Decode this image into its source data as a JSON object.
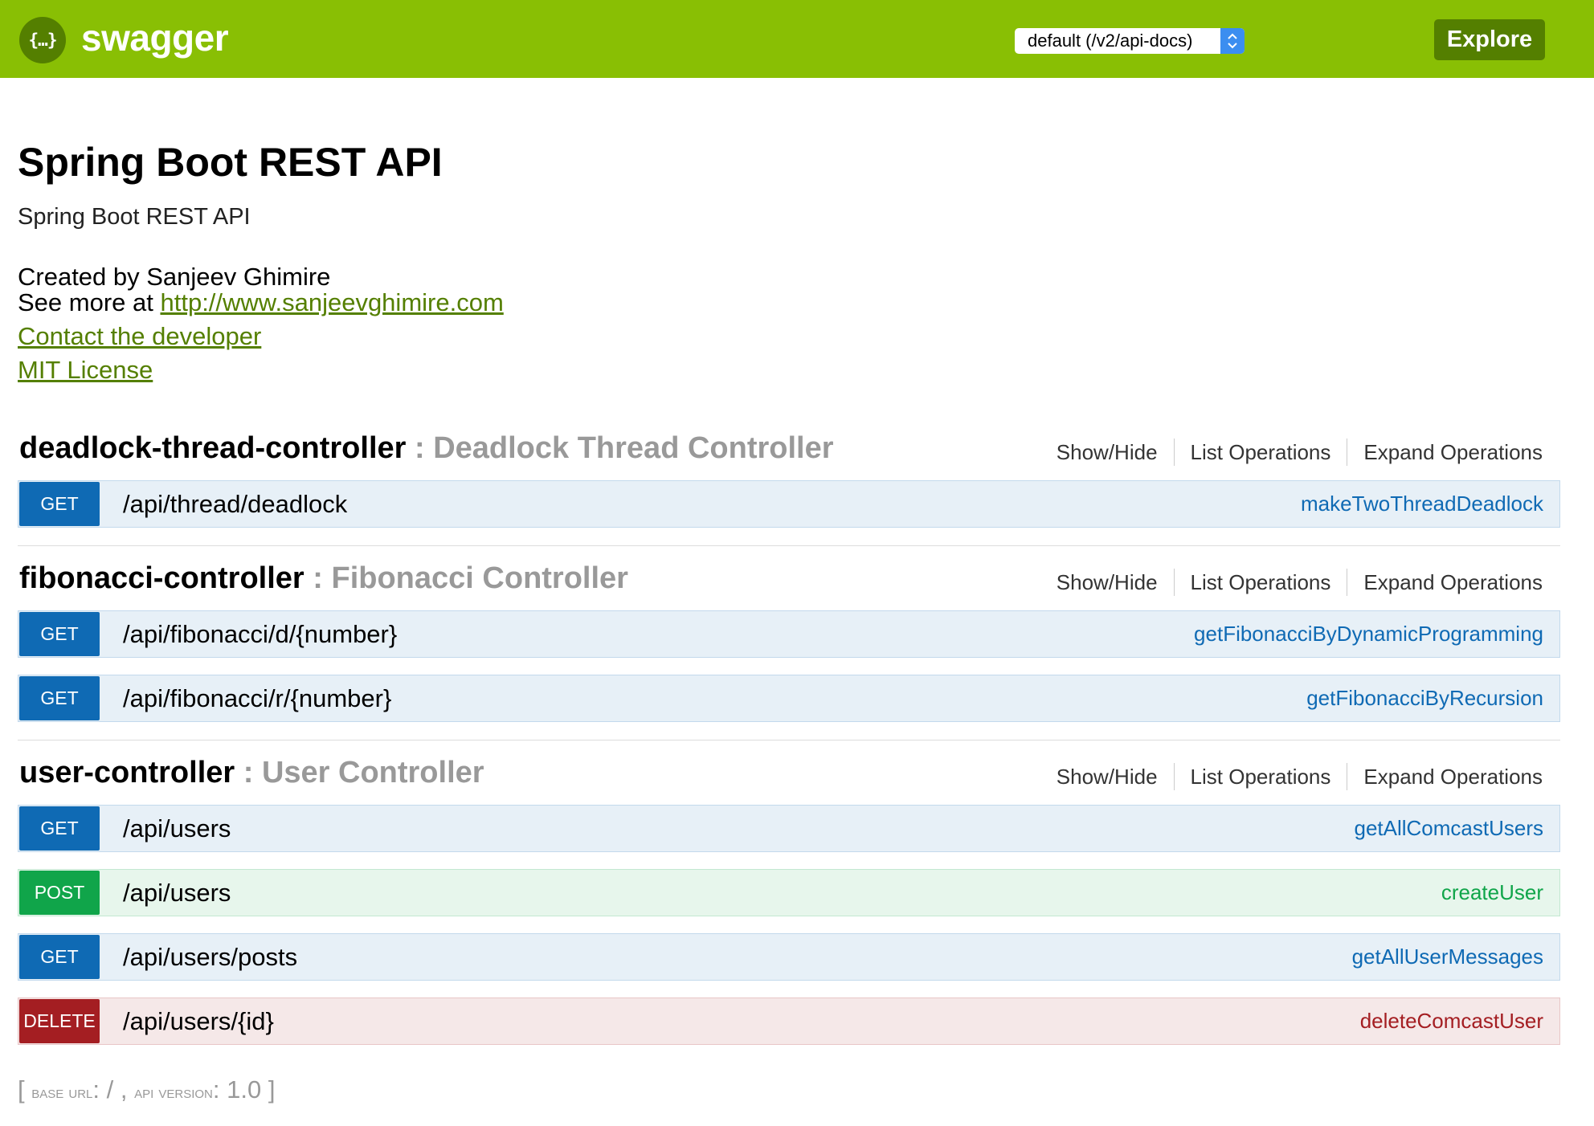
{
  "header": {
    "logo_glyph": "{…}",
    "logo_text": "swagger",
    "spec_select": "default (/v2/api-docs)",
    "select_arrows": "⌃\n⌄",
    "explore_label": "Explore"
  },
  "info": {
    "title": "Spring Boot REST API",
    "description": "Spring Boot REST API",
    "created_by": "Created by Sanjeev Ghimire",
    "see_more_prefix": "See more at ",
    "website": "http://www.sanjeevghimire.com",
    "contact": "Contact the developer",
    "license": "MIT License"
  },
  "resource_options": [
    "Show/Hide",
    "List Operations",
    "Expand Operations"
  ],
  "resources": [
    {
      "name": "deadlock-thread-controller",
      "description": " : Deadlock Thread Controller",
      "operations": [
        {
          "method": "GET",
          "path": "/api/thread/deadlock",
          "nickname": "makeTwoThreadDeadlock"
        }
      ]
    },
    {
      "name": "fibonacci-controller",
      "description": " : Fibonacci Controller",
      "operations": [
        {
          "method": "GET",
          "path": "/api/fibonacci/d/{number}",
          "nickname": "getFibonacciByDynamicProgramming"
        },
        {
          "method": "GET",
          "path": "/api/fibonacci/r/{number}",
          "nickname": "getFibonacciByRecursion"
        }
      ]
    },
    {
      "name": "user-controller",
      "description": " : User Controller",
      "operations": [
        {
          "method": "GET",
          "path": "/api/users",
          "nickname": "getAllComcastUsers"
        },
        {
          "method": "POST",
          "path": "/api/users",
          "nickname": "createUser"
        },
        {
          "method": "GET",
          "path": "/api/users/posts",
          "nickname": "getAllUserMessages"
        },
        {
          "method": "DELETE",
          "path": "/api/users/{id}",
          "nickname": "deleteComcastUser"
        }
      ]
    }
  ],
  "footer": {
    "open_bracket": "[ ",
    "base_url_label": "base url",
    "base_url_value": ": / , ",
    "api_version_label": "api version",
    "api_version_value": ": 1.0 ",
    "close_bracket": "]"
  },
  "colors": {
    "header_bg": "#89bf04",
    "header_dark": "#547f00",
    "get": "#0f6ab4",
    "post": "#10a54a",
    "delete": "#a41e22"
  }
}
